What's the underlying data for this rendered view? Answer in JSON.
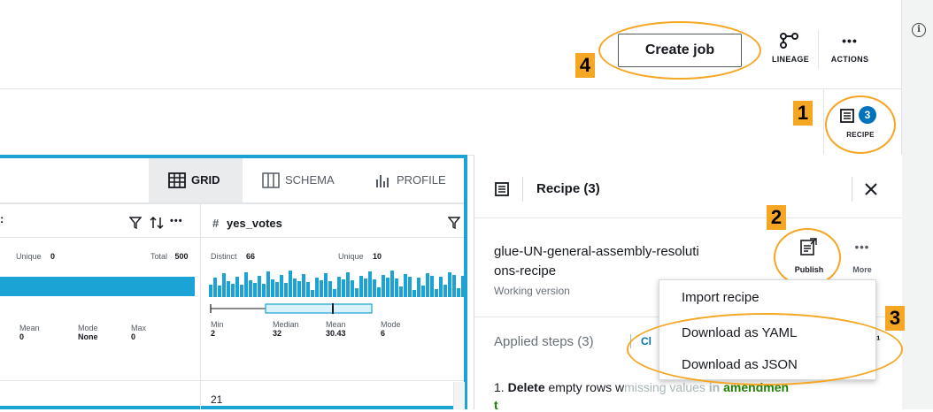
{
  "toolbar": {
    "create_job_label": "Create job",
    "lineage_label": "LINEAGE",
    "actions_label": "ACTIONS",
    "recipe_label": "RECIPE",
    "recipe_count": "3"
  },
  "badges": {
    "b1": "1",
    "b2": "2",
    "b3": "3",
    "b4": "4"
  },
  "view_tabs": {
    "grid": "GRID",
    "schema": "SCHEMA",
    "profile": "PROFILE"
  },
  "grid": {
    "col1": {
      "unique_label": "Unique",
      "unique_value": "0",
      "total_label": "Total",
      "total_value": "500",
      "stats": [
        {
          "label": "Mean",
          "value": "0"
        },
        {
          "label": "Mode",
          "value": "None"
        },
        {
          "label": "Max",
          "value": "0"
        }
      ]
    },
    "col2": {
      "hash": "#",
      "name": "yes_votes",
      "distinct_label": "Distinct",
      "distinct_value": "66",
      "unique_label": "Unique",
      "unique_value": "10",
      "stats": [
        {
          "label": "Min",
          "value": "2"
        },
        {
          "label": "Median",
          "value": "32"
        },
        {
          "label": "Mean",
          "value": "30.43"
        },
        {
          "label": "Mode",
          "value": "6"
        }
      ],
      "first_cell": "21"
    },
    "menu_dots": "•••"
  },
  "recipe": {
    "header_title": "Recipe (3)",
    "name_line1": "glue-UN-general-assembly-resoluti",
    "name_line2": "ons-recipe",
    "version": "Working version",
    "publish_label": "Publish",
    "more_label": "More",
    "more_dots": "•••",
    "applied_steps": "Applied steps (3)",
    "clear_partial": "Cl",
    "step1_num": "1.",
    "step1_action": "Delete",
    "step1_text_a": "empty rows w",
    "step1_text_b": "missing values",
    "step1_text_c": "in",
    "step1_text_d": "amendmen",
    "step1_text_e": "t"
  },
  "more_menu": {
    "items": [
      "Import recipe",
      "Download as YAML",
      "Download as JSON"
    ]
  },
  "colors": {
    "accent_blue": "#1aa3d4",
    "highlight_orange": "#f5a623",
    "step_green": "#1d8102"
  }
}
